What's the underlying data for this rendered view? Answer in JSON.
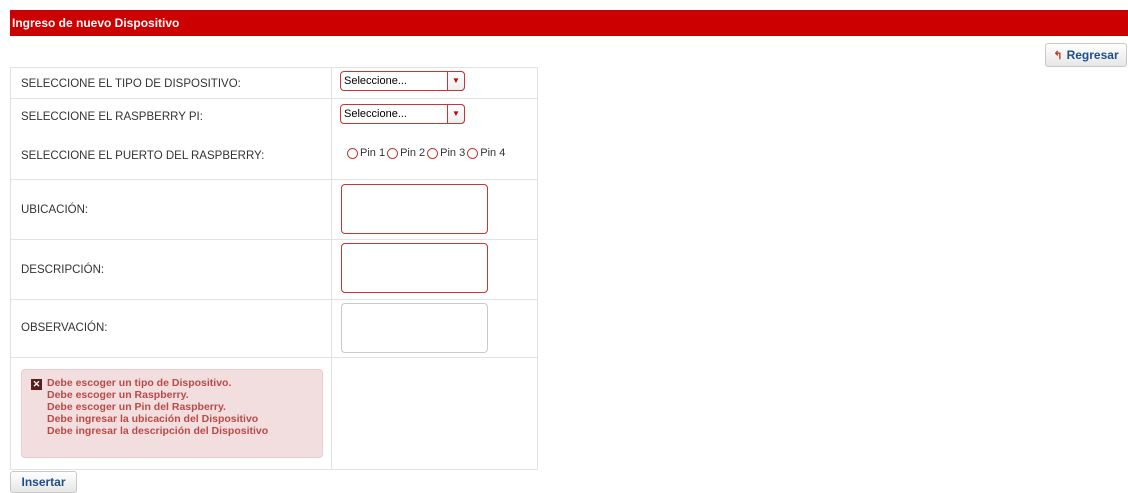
{
  "header": {
    "title": "Ingreso de nuevo Dispositivo"
  },
  "back_button": {
    "label": "Regresar",
    "icon": "reply-arrow-icon"
  },
  "form": {
    "device_type": {
      "label": "SELECCIONE EL TIPO DE DISPOSITIVO:",
      "selected": "Seleccione..."
    },
    "raspberry": {
      "label": "SELECCIONE EL RASPBERRY PI:",
      "selected": "Seleccione..."
    },
    "port": {
      "label": "SELECCIONE EL PUERTO DEL RASPBERRY:",
      "options": [
        "Pin 1",
        "Pin 2",
        "Pin 3",
        "Pin 4"
      ]
    },
    "location": {
      "label": "UBICACIÓN:",
      "value": ""
    },
    "description": {
      "label": "DESCRIPCIÓN:",
      "value": ""
    },
    "observation": {
      "label": "OBSERVACIÓN:",
      "value": ""
    }
  },
  "errors": [
    "Debe escoger un tipo de Dispositivo.",
    "Debe escoger un Raspberry.",
    "Debe escoger un Pin del Raspberry.",
    "Debe ingresar la ubicación del Dispositivo",
    "Debe ingresar la descripción del Dispositivo"
  ],
  "insert_button": {
    "label": "Insertar"
  },
  "colors": {
    "header_bg": "#cc0000",
    "error_text": "#b94a48",
    "error_bg": "#f2dede",
    "invalid_border": "#cc3333"
  }
}
